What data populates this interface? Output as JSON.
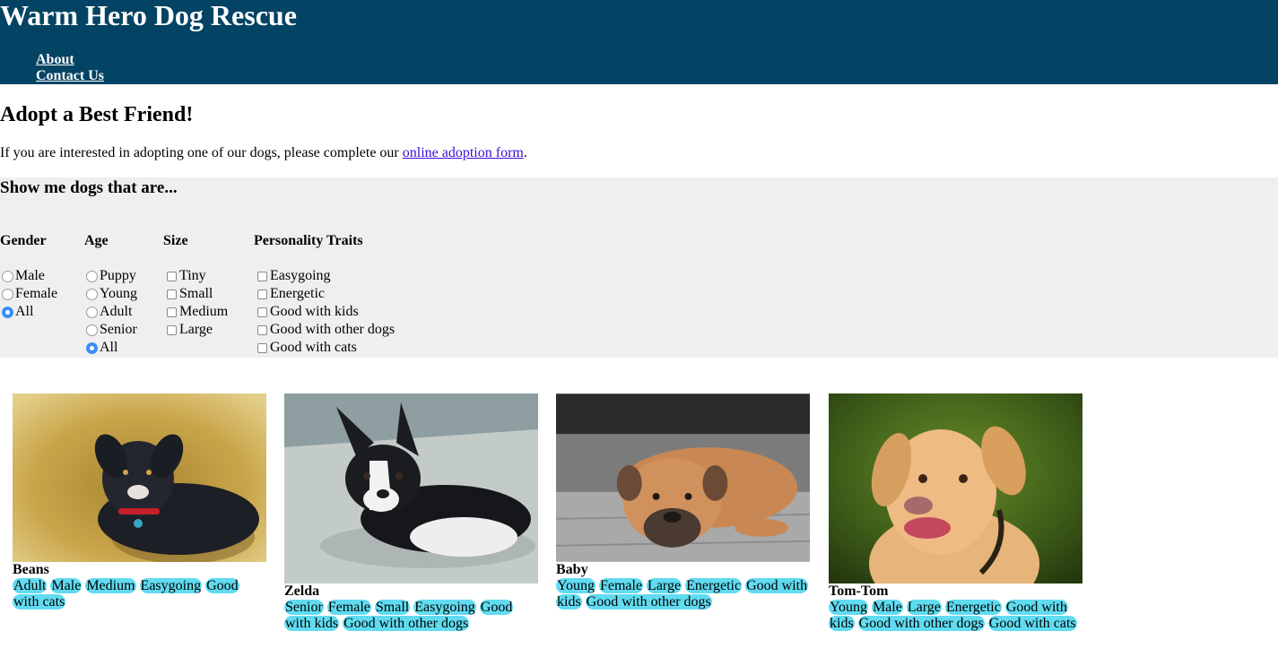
{
  "site": {
    "title": "Warm Hero Dog Rescue",
    "nav": [
      {
        "label": "About"
      },
      {
        "label": "Contact Us"
      }
    ]
  },
  "intro": {
    "heading": "Adopt a Best Friend!",
    "text_before": "If you are interested in adopting one of our dogs, please complete our ",
    "link_label": "online adoption form",
    "text_after": "."
  },
  "filters": {
    "heading": "Show me dogs that are...",
    "gender": {
      "label": "Gender",
      "options": [
        "Male",
        "Female",
        "All"
      ],
      "selected": "All"
    },
    "age": {
      "label": "Age",
      "options": [
        "Puppy",
        "Young",
        "Adult",
        "Senior",
        "All"
      ],
      "selected": "All"
    },
    "size": {
      "label": "Size",
      "options": [
        "Tiny",
        "Small",
        "Medium",
        "Large"
      ],
      "checked": []
    },
    "personality": {
      "label": "Personality Traits",
      "options": [
        "Easygoing",
        "Energetic",
        "Good with kids",
        "Good with other dogs",
        "Good with cats"
      ],
      "checked": []
    }
  },
  "dogs": [
    {
      "name": "Beans",
      "tags": [
        "Adult",
        "Male",
        "Medium",
        "Easygoing",
        "Good with cats"
      ]
    },
    {
      "name": "Zelda",
      "tags": [
        "Senior",
        "Female",
        "Small",
        "Easygoing",
        "Good with kids",
        "Good with other dogs"
      ]
    },
    {
      "name": "Baby",
      "tags": [
        "Young",
        "Female",
        "Large",
        "Energetic",
        "Good with kids",
        "Good with other dogs"
      ]
    },
    {
      "name": "Tom-Tom",
      "tags": [
        "Young",
        "Male",
        "Large",
        "Energetic",
        "Good with kids",
        "Good with other dogs",
        "Good with cats"
      ]
    }
  ],
  "colors": {
    "header_bg": "#034363",
    "filter_bg": "#efefef",
    "tag_bg": "#60dbf0",
    "radio_on": "#3c8ef5"
  }
}
